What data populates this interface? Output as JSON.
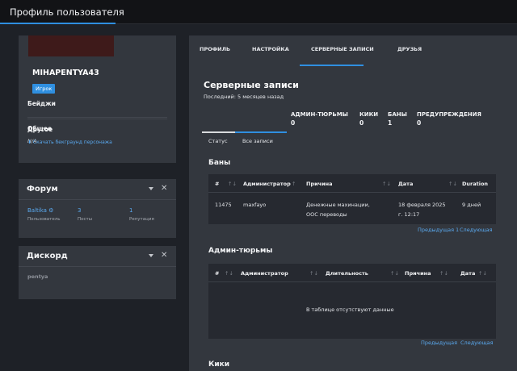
{
  "header": {
    "title": "Профиль пользователя"
  },
  "profile": {
    "username": "MIHAPENTYA43",
    "role": "Игрок",
    "badges_label": "Бейджи",
    "general_label": "Общее",
    "general_value": "N/A",
    "other_label": "Другое",
    "download_link": "⬇ Скачать бекграунд персонажа"
  },
  "forum": {
    "title": "Форум",
    "username": "Baltika ⚙",
    "username_label": "Пользователь",
    "posts": "3",
    "posts_label": "Посты",
    "reputation": "1",
    "reputation_label": "Репутация"
  },
  "discord": {
    "title": "Дискорд",
    "name": "pentya"
  },
  "tabs": [
    "ПРОФИЛЬ",
    "НАСТРОЙКА",
    "СЕРВЕРНЫЕ ЗАПИСИ",
    "ДРУЗЬЯ"
  ],
  "records": {
    "title": "Серверные записи",
    "last": "Последний: 5 месяцев назад",
    "summary": [
      {
        "label": "АДМИН-ТЮРЬМЫ",
        "value": "0"
      },
      {
        "label": "КИКИ",
        "value": "0"
      },
      {
        "label": "БАНЫ",
        "value": "1"
      },
      {
        "label": "ПРЕДУПРЕЖДЕНИЯ",
        "value": "0"
      }
    ],
    "subtabs": [
      "Статус",
      "Все записи"
    ]
  },
  "bans": {
    "title": "Баны",
    "columns": [
      "#",
      "Администратор",
      "Причина",
      "Дата",
      "Duration"
    ],
    "row": {
      "id": "11475",
      "admin": "maxfayo",
      "reason_line1": "Денежные махинации,",
      "reason_line2": "OOC переводы",
      "date_line1": "18 февраля 2025",
      "date_line2": "г. 12:17",
      "duration": "9 дней"
    },
    "pager_prev": "Предыдущая",
    "pager_page": "1",
    "pager_next": "Следующая"
  },
  "jails": {
    "title": "Админ-тюрьмы",
    "columns": [
      "#",
      "Администратор",
      "Длительность",
      "Причина",
      "Дата"
    ],
    "empty": "В таблице отсутствуют данные",
    "pager_prev": "Предыдущая",
    "pager_next": "Следующая"
  },
  "kicks": {
    "title": "Кики"
  },
  "colors": {
    "accent": "#2f8fe0",
    "panel": "#33373e",
    "background": "#1e2127",
    "link": "#5aa9ef"
  }
}
